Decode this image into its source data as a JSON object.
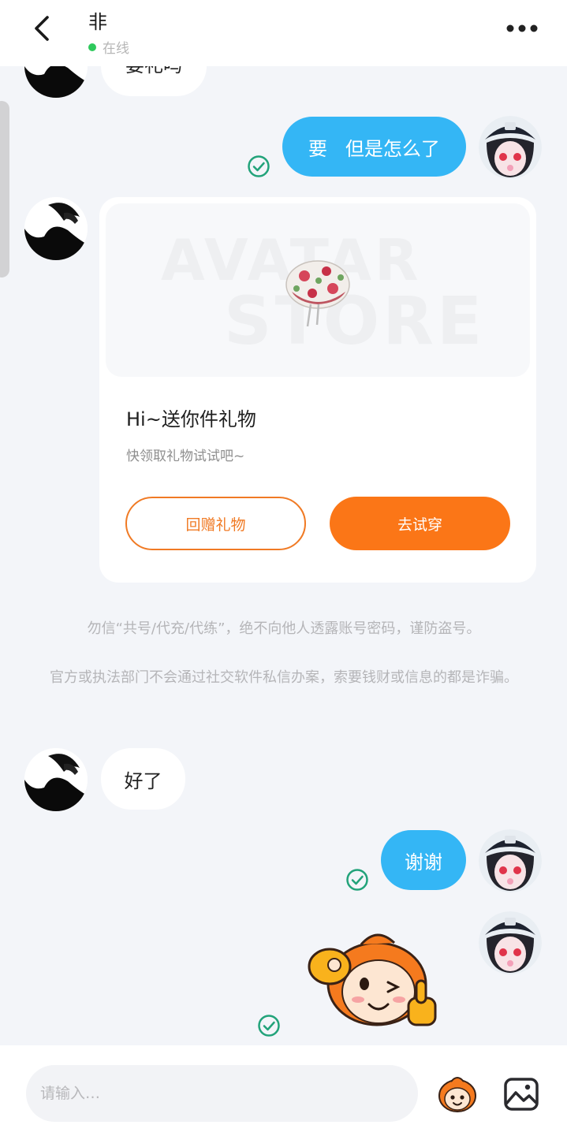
{
  "header": {
    "title": "非 ",
    "status": "在线"
  },
  "messages": {
    "partial_top": "要礼吗",
    "sent_1": "要   但是怎么了",
    "received_1": "好了",
    "sent_2": "谢谢"
  },
  "gift_card": {
    "watermark_line1": "AVATAR",
    "watermark_line2": "STORE",
    "title": "Hi~送你件礼物",
    "subtitle": "快领取礼物试试吧~",
    "return_gift_label": "回赠礼物",
    "try_on_label": "去试穿"
  },
  "notices": {
    "line1": "勿信“共号/代充/代练”，绝不向他人透露账号密码，谨防盗号。",
    "line2": "官方或执法部门不会通过社交软件私信办案，索要钱财或信息的都是诈骗。"
  },
  "input": {
    "placeholder": "请输入…"
  },
  "colors": {
    "sent_bubble": "#34b6f5",
    "accent_orange": "#fb7617",
    "online_green": "#2ec95c",
    "read_check": "#22a37a"
  },
  "icons": [
    "back-arrow-icon",
    "more-dots-icon",
    "read-check-icon",
    "gift-hat-icon",
    "sticker-icon",
    "image-icon"
  ]
}
